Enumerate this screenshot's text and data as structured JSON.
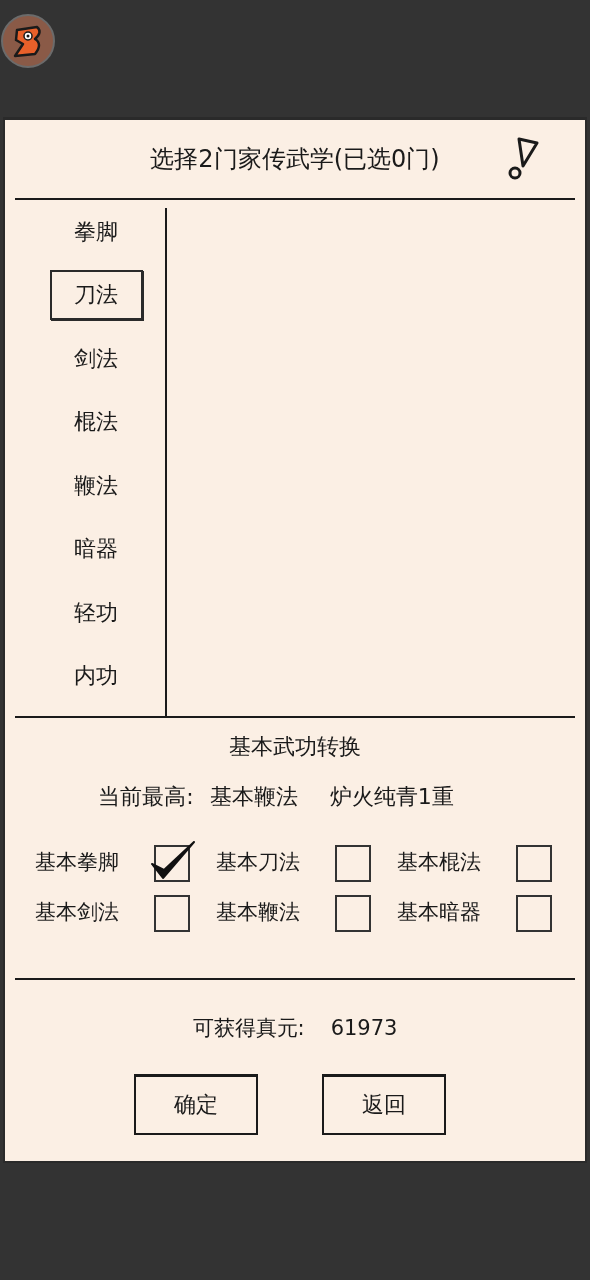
{
  "dialog": {
    "title": "选择2门家传武学(已选0门)"
  },
  "categories": [
    {
      "label": "拳脚",
      "selected": false
    },
    {
      "label": "刀法",
      "selected": true
    },
    {
      "label": "剑法",
      "selected": false
    },
    {
      "label": "棍法",
      "selected": false
    },
    {
      "label": "鞭法",
      "selected": false
    },
    {
      "label": "暗器",
      "selected": false
    },
    {
      "label": "轻功",
      "selected": false
    },
    {
      "label": "内功",
      "selected": false
    }
  ],
  "conversion": {
    "heading": "基本武功转换",
    "current_label": "当前最高:",
    "current_skill": "基本鞭法",
    "current_level": "炉火纯青1重",
    "options": [
      {
        "label": "基本拳脚",
        "checked": true
      },
      {
        "label": "基本刀法",
        "checked": false
      },
      {
        "label": "基本棍法",
        "checked": false
      },
      {
        "label": "基本剑法",
        "checked": false
      },
      {
        "label": "基本鞭法",
        "checked": false
      },
      {
        "label": "基本暗器",
        "checked": false
      }
    ]
  },
  "reward": {
    "label": "可获得真元:",
    "value": "61973"
  },
  "buttons": [
    "确定",
    "返回"
  ]
}
